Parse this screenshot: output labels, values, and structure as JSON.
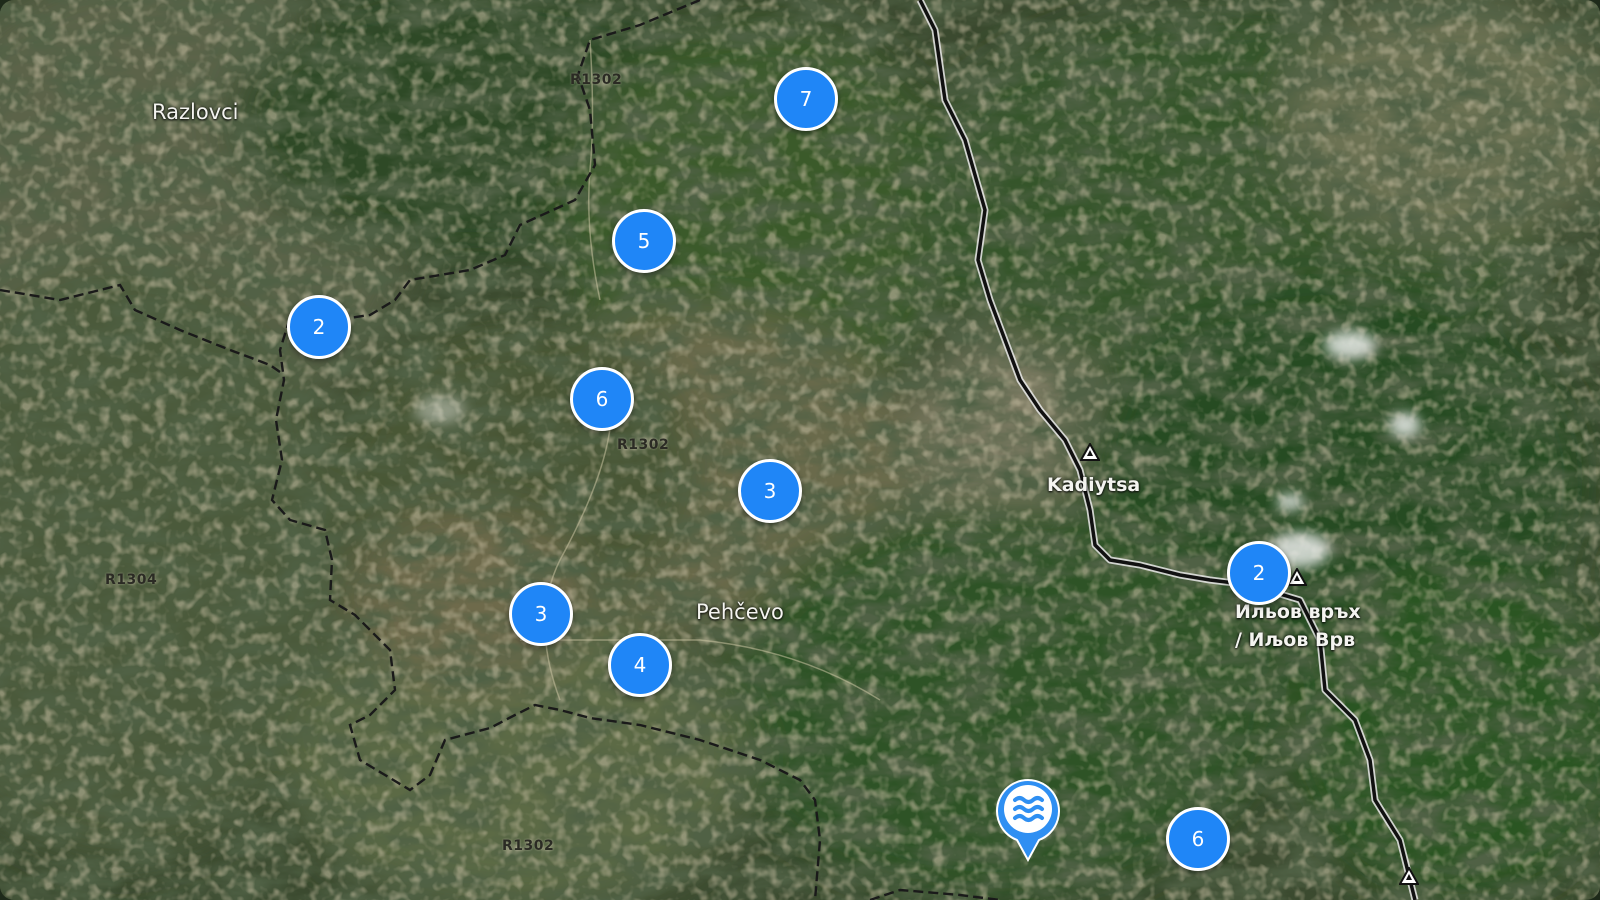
{
  "map": {
    "place_labels": [
      {
        "id": "razlovci",
        "text": "Razlovci"
      },
      {
        "id": "pehcevo",
        "text": "Pehčevo"
      },
      {
        "id": "kadiytsa",
        "text": "Kadiytsa"
      },
      {
        "id": "ilyov-vrah",
        "text": "Ильов връх\n/ Иљов Врв"
      }
    ],
    "road_labels": [
      "R1302",
      "R1302",
      "R1304",
      "R1302"
    ],
    "clusters": [
      {
        "id": "c7",
        "count": "7"
      },
      {
        "id": "c5",
        "count": "5"
      },
      {
        "id": "c2-west",
        "count": "2"
      },
      {
        "id": "c6-north",
        "count": "6"
      },
      {
        "id": "c3-east",
        "count": "3"
      },
      {
        "id": "c3-west",
        "count": "3"
      },
      {
        "id": "c4",
        "count": "4"
      },
      {
        "id": "c2-east",
        "count": "2"
      },
      {
        "id": "c6-south",
        "count": "6"
      }
    ],
    "water_marker": {
      "icon": "water-waves-icon",
      "color": "#2f8ff2"
    },
    "colors": {
      "cluster": "#1f86f7",
      "cluster_border": "#ffffff",
      "border_line": "#111111"
    }
  }
}
